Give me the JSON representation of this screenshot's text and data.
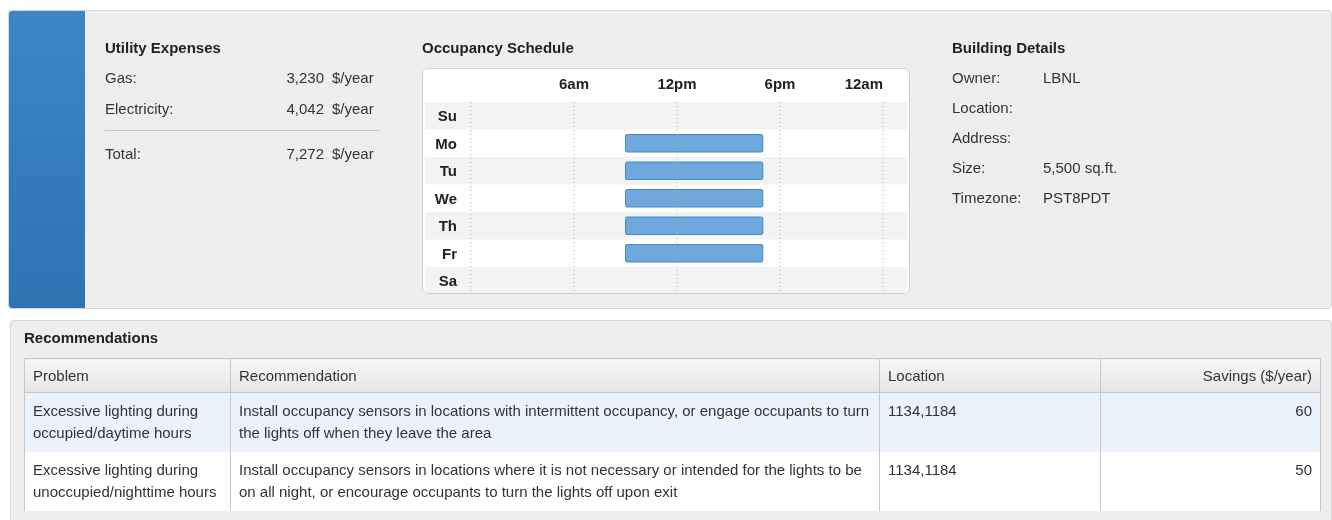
{
  "utility_expenses": {
    "title": "Utility Expenses",
    "rows": [
      {
        "label": "Gas:",
        "value": "3,230",
        "unit": "$/year",
        "kind": "item"
      },
      {
        "label": "Electricity:",
        "value": "4,042",
        "unit": "$/year",
        "kind": "item"
      },
      {
        "label": "Total:",
        "value": "7,272",
        "unit": "$/year",
        "kind": "total"
      }
    ]
  },
  "occupancy_schedule": {
    "title": "Occupancy Schedule",
    "time_labels": [
      "6am",
      "12pm",
      "6pm",
      "12am"
    ],
    "days": [
      {
        "label": "Su",
        "occupied": false
      },
      {
        "label": "Mo",
        "occupied": true
      },
      {
        "label": "Tu",
        "occupied": true
      },
      {
        "label": "We",
        "occupied": true
      },
      {
        "label": "Th",
        "occupied": true
      },
      {
        "label": "Fr",
        "occupied": true
      },
      {
        "label": "Sa",
        "occupied": false
      }
    ]
  },
  "building_details": {
    "title": "Building Details",
    "rows": [
      {
        "label": "Owner:",
        "value": "LBNL"
      },
      {
        "label": "Location:"
      },
      {
        "label": "Address:"
      },
      {
        "label": "Size:",
        "value": "5,500 sq.ft."
      },
      {
        "label": "Timezone:",
        "value": "PST8PDT"
      }
    ]
  },
  "recommendations": {
    "title": "Recommendations",
    "columns": [
      "Problem",
      "Recommendation",
      "Location",
      "Savings ($/year)"
    ],
    "rows": [
      {
        "problem": "Excessive lighting during occupied/daytime hours",
        "recommendation": "Install occupancy sensors in locations with intermittent occupancy, or engage occupants to turn the lights off when they leave the area",
        "location": "1134,1184",
        "savings": "60",
        "selected": true
      },
      {
        "problem": "Excessive lighting during unoccupied/nighttime hours",
        "recommendation": "Install occupancy sensors in locations where it is not necessary or intended for the lights to be on all night, or encourage occupants to turn the lights off upon exit",
        "location": "1134,1184",
        "savings": "50",
        "selected": false
      }
    ]
  }
}
